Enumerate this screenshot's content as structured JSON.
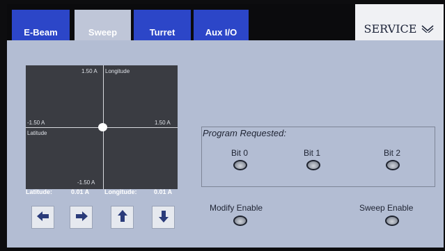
{
  "tabs": [
    {
      "label": "E-Beam",
      "active": false
    },
    {
      "label": "Sweep",
      "active": true
    },
    {
      "label": "Turret",
      "active": false
    },
    {
      "label": "Aux I/O",
      "active": false
    }
  ],
  "service": {
    "label": "SERVICE",
    "icon": "chevron-down-icon"
  },
  "plot": {
    "y_max_label": "1.50 A",
    "y_axis_label": "Longitude",
    "x_min_label": "-1.50 A",
    "x_max_label": "1.50 A",
    "x_axis_label": "Latitude",
    "y_min_label": "-1.50 A"
  },
  "readout": {
    "latitude_label": "Latitude:",
    "latitude_value": "0.01 A",
    "longitude_label": "Longitude:",
    "longitude_value": "0.01 A"
  },
  "arrows": [
    {
      "name": "left-arrow-button",
      "icon": "arrow-left-icon"
    },
    {
      "name": "right-arrow-button",
      "icon": "arrow-right-icon"
    },
    {
      "name": "up-arrow-button",
      "icon": "arrow-up-icon"
    },
    {
      "name": "down-arrow-button",
      "icon": "arrow-down-icon"
    }
  ],
  "program": {
    "title": "Program Requested:",
    "bits": [
      "Bit 0",
      "Bit 1",
      "Bit 2"
    ]
  },
  "indicators": {
    "modify_enable": "Modify Enable",
    "sweep_enable": "Sweep Enable"
  },
  "colors": {
    "tab_blue": "#2c46c8",
    "panel_bg": "#b3bdd3",
    "plot_bg": "#3a3c42"
  }
}
